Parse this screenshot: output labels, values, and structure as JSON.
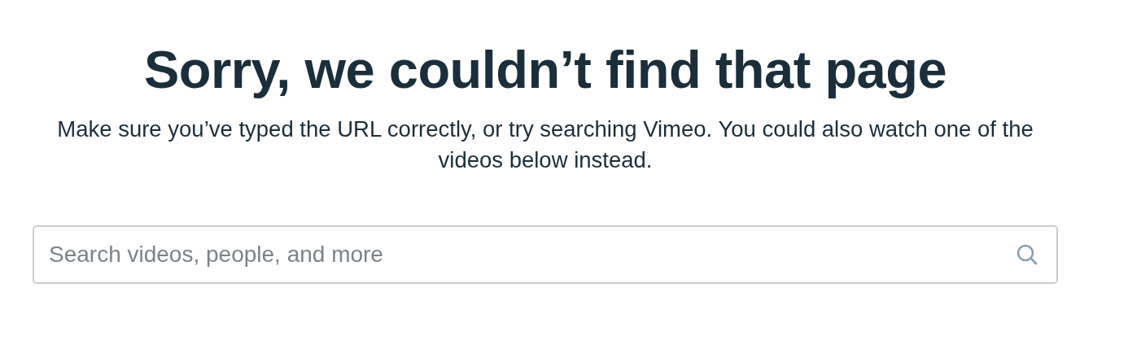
{
  "heading": "Sorry, we couldn’t find that page",
  "message": "Make sure you’ve typed the URL correctly, or try searching Vimeo. You could also watch one of the videos below instead.",
  "search": {
    "placeholder": "Search videos, people, and more"
  }
}
